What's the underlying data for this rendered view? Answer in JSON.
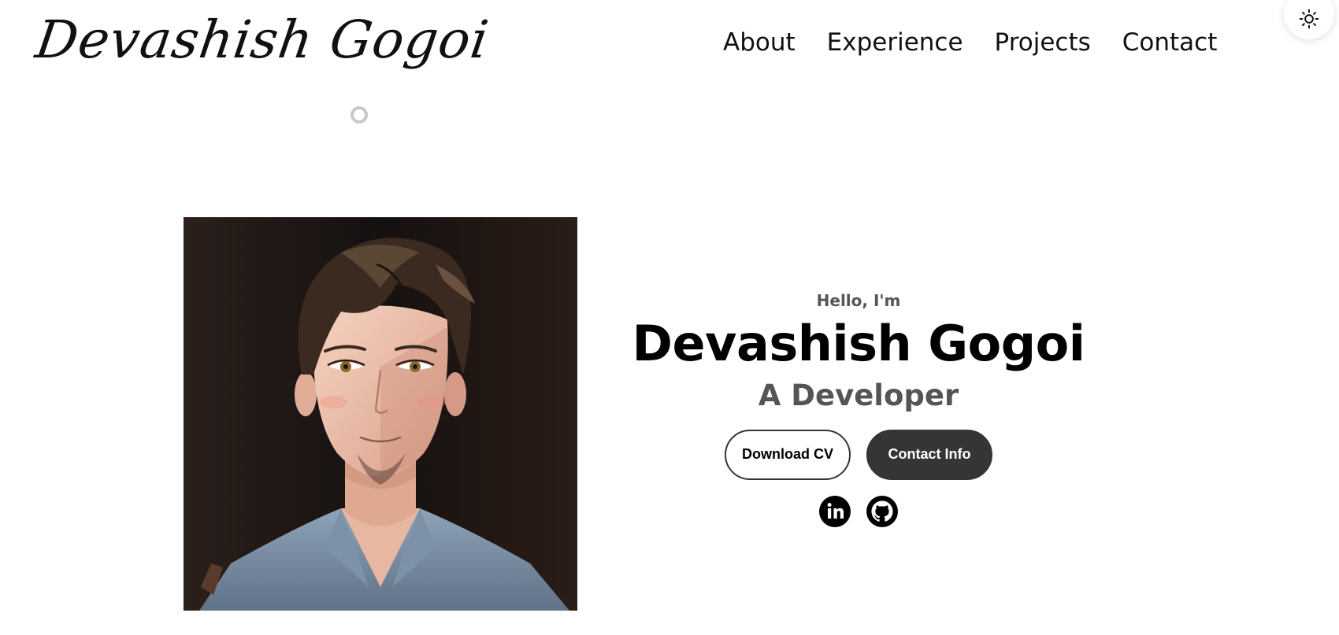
{
  "header": {
    "logo_text": "Devashish Gogoi",
    "nav": [
      {
        "label": "About"
      },
      {
        "label": "Experience"
      },
      {
        "label": "Projects"
      },
      {
        "label": "Contact"
      }
    ],
    "theme_toggle_icon": "sun-icon"
  },
  "hero": {
    "greeting": "Hello, I'm",
    "name": "Devashish Gogoi",
    "role": "A Developer",
    "buttons": {
      "download_cv": "Download CV",
      "contact_info": "Contact Info"
    },
    "socials": [
      {
        "icon": "linkedin-icon"
      },
      {
        "icon": "github-icon"
      }
    ]
  },
  "colors": {
    "button_dark": "#353535",
    "text_muted": "#555555",
    "loader_ring": "#c8c8c8"
  }
}
